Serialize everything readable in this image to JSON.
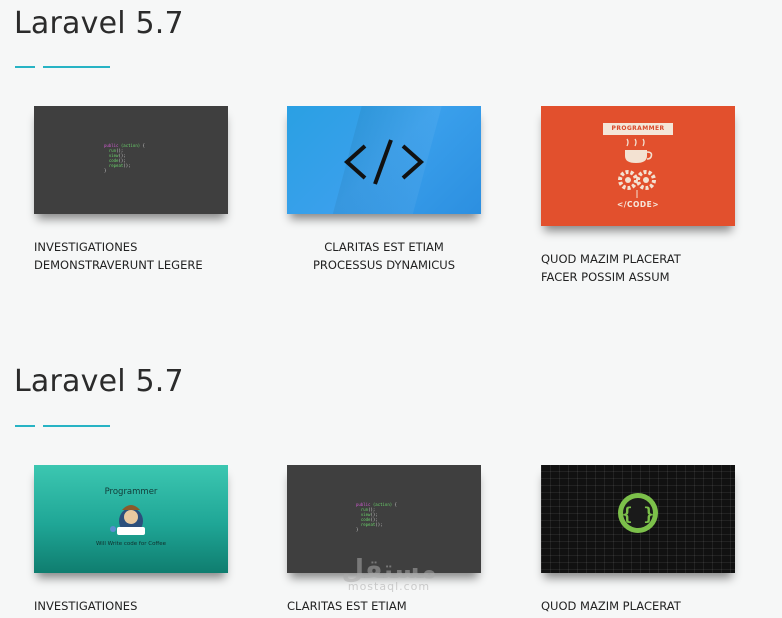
{
  "colors": {
    "accent": "#27b3c4",
    "background": "#f6f7f7"
  },
  "sections": [
    {
      "title": "Laravel 5.7",
      "cards": [
        {
          "thumbnail": "code-editor-dark",
          "caption_lines": [
            "INVESTIGATIONES",
            "DEMONSTRAVERUNT LEGERE"
          ]
        },
        {
          "thumbnail": "code-brackets-blue",
          "caption_lines": [
            "CLARITAS EST ETIAM",
            "PROCESSUS DYNAMICUS"
          ]
        },
        {
          "thumbnail": "programmer-poster-orange",
          "thumbnail_text": {
            "banner": "PROGRAMMER",
            "footer": "</CODE>"
          },
          "caption_lines": [
            "QUOD MAZIM PLACERAT",
            "FACER POSSIM ASSUM"
          ]
        }
      ]
    },
    {
      "title": "Laravel 5.7",
      "cards": [
        {
          "thumbnail": "programmer-coffee-teal",
          "thumbnail_text": {
            "heading": "Programmer",
            "sub": "Will Write code for Coffee"
          },
          "caption_lines": [
            "INVESTIGATIONES"
          ]
        },
        {
          "thumbnail": "code-editor-dark",
          "caption_lines": [
            "CLARITAS EST ETIAM"
          ]
        },
        {
          "thumbnail": "curly-braces-black",
          "caption_lines": [
            "QUOD MAZIM PLACERAT"
          ]
        }
      ]
    }
  ],
  "watermark": {
    "arabic": "مستقل",
    "latin": "mostaql.com"
  }
}
